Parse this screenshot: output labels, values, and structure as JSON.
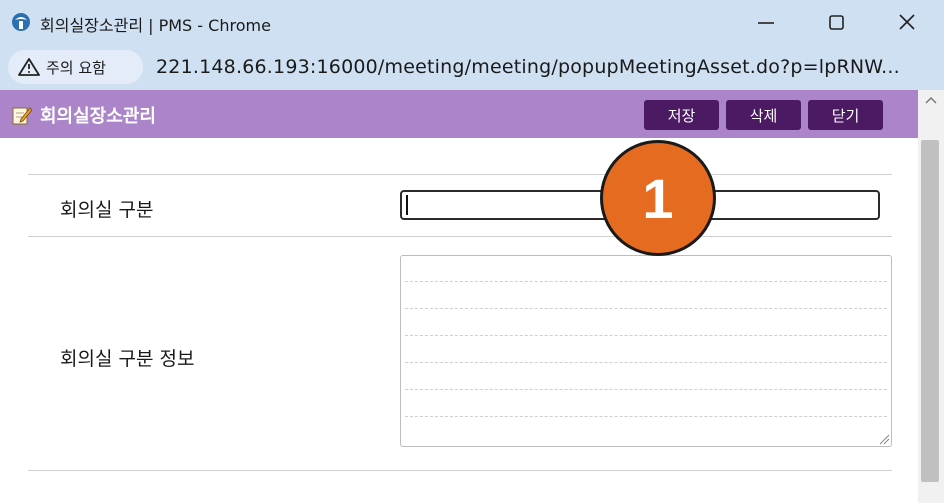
{
  "window": {
    "title": "회의실장소관리 | PMS - Chrome",
    "controls": [
      "minimize",
      "maximize",
      "close"
    ]
  },
  "address_bar": {
    "security_chip": "주의 요함",
    "url": "221.148.66.193:16000/meeting/meeting/popupMeetingAsset.do?p=lpRNW..."
  },
  "header": {
    "title": "회의실장소관리",
    "buttons": {
      "save": "저장",
      "delete": "삭제",
      "close": "닫기"
    }
  },
  "form": {
    "category_label": "회의실 구분",
    "category_value": "",
    "info_label": "회의실 구분 정보",
    "info_value": ""
  },
  "annotation": {
    "marker": "1",
    "color": "#e46b1f"
  },
  "colors": {
    "header_bg": "#ab84c9",
    "button_bg": "#4b1a63",
    "chrome_bg": "#cfe0f3"
  }
}
